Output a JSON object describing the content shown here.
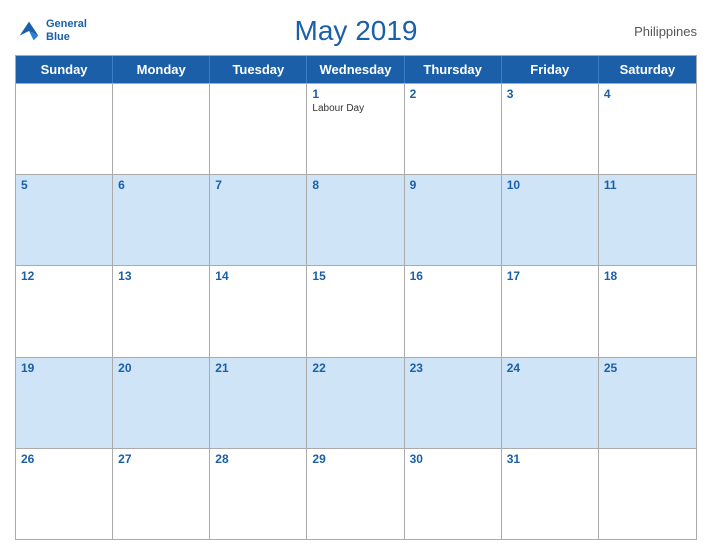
{
  "header": {
    "title": "May 2019",
    "country": "Philippines",
    "logo": {
      "line1": "General",
      "line2": "Blue"
    }
  },
  "dayHeaders": [
    "Sunday",
    "Monday",
    "Tuesday",
    "Wednesday",
    "Thursday",
    "Friday",
    "Saturday"
  ],
  "weeks": [
    [
      {
        "day": "",
        "empty": true,
        "blue": false
      },
      {
        "day": "",
        "empty": true,
        "blue": false
      },
      {
        "day": "",
        "empty": true,
        "blue": false
      },
      {
        "day": "1",
        "holiday": "Labour Day",
        "blue": false
      },
      {
        "day": "2",
        "blue": false
      },
      {
        "day": "3",
        "blue": false
      },
      {
        "day": "4",
        "blue": false
      }
    ],
    [
      {
        "day": "5",
        "blue": true
      },
      {
        "day": "6",
        "blue": true
      },
      {
        "day": "7",
        "blue": true
      },
      {
        "day": "8",
        "blue": true
      },
      {
        "day": "9",
        "blue": true
      },
      {
        "day": "10",
        "blue": true
      },
      {
        "day": "11",
        "blue": true
      }
    ],
    [
      {
        "day": "12",
        "blue": false
      },
      {
        "day": "13",
        "blue": false
      },
      {
        "day": "14",
        "blue": false
      },
      {
        "day": "15",
        "blue": false
      },
      {
        "day": "16",
        "blue": false
      },
      {
        "day": "17",
        "blue": false
      },
      {
        "day": "18",
        "blue": false
      }
    ],
    [
      {
        "day": "19",
        "blue": true
      },
      {
        "day": "20",
        "blue": true
      },
      {
        "day": "21",
        "blue": true
      },
      {
        "day": "22",
        "blue": true
      },
      {
        "day": "23",
        "blue": true
      },
      {
        "day": "24",
        "blue": true
      },
      {
        "day": "25",
        "blue": true
      }
    ],
    [
      {
        "day": "26",
        "blue": false
      },
      {
        "day": "27",
        "blue": false
      },
      {
        "day": "28",
        "blue": false
      },
      {
        "day": "29",
        "blue": false
      },
      {
        "day": "30",
        "blue": false
      },
      {
        "day": "31",
        "blue": false
      },
      {
        "day": "",
        "empty": true,
        "blue": false
      }
    ]
  ]
}
